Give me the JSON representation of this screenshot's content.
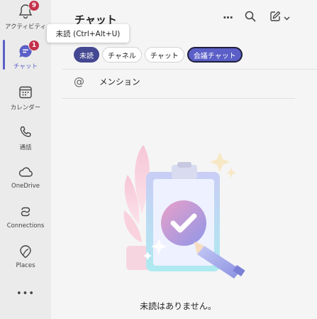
{
  "rail": {
    "items": [
      {
        "label": "アクティビティ",
        "badge": "9",
        "icon": "bell-icon"
      },
      {
        "label": "チャット",
        "badge": "1",
        "icon": "chat-icon"
      },
      {
        "label": "カレンダー",
        "icon": "calendar-icon"
      },
      {
        "label": "通話",
        "icon": "phone-icon"
      },
      {
        "label": "OneDrive",
        "icon": "cloud-icon"
      },
      {
        "label": "Connections",
        "icon": "connections-icon"
      },
      {
        "label": "Places",
        "icon": "places-icon"
      }
    ],
    "more": "•••"
  },
  "header": {
    "title": "チャット",
    "more": "···"
  },
  "tooltip": "未読 (Ctrl+Alt+U)",
  "filters": [
    "未読",
    "チャネル",
    "チャット",
    "会議チャット"
  ],
  "mention": {
    "at": "@",
    "label": "メンション"
  },
  "empty_state": "未読はありません。",
  "colors": {
    "accent": "#5b5fc7",
    "selected_pill": "#444791",
    "badge": "#c4314b",
    "rail_bg": "#ebebeb"
  }
}
